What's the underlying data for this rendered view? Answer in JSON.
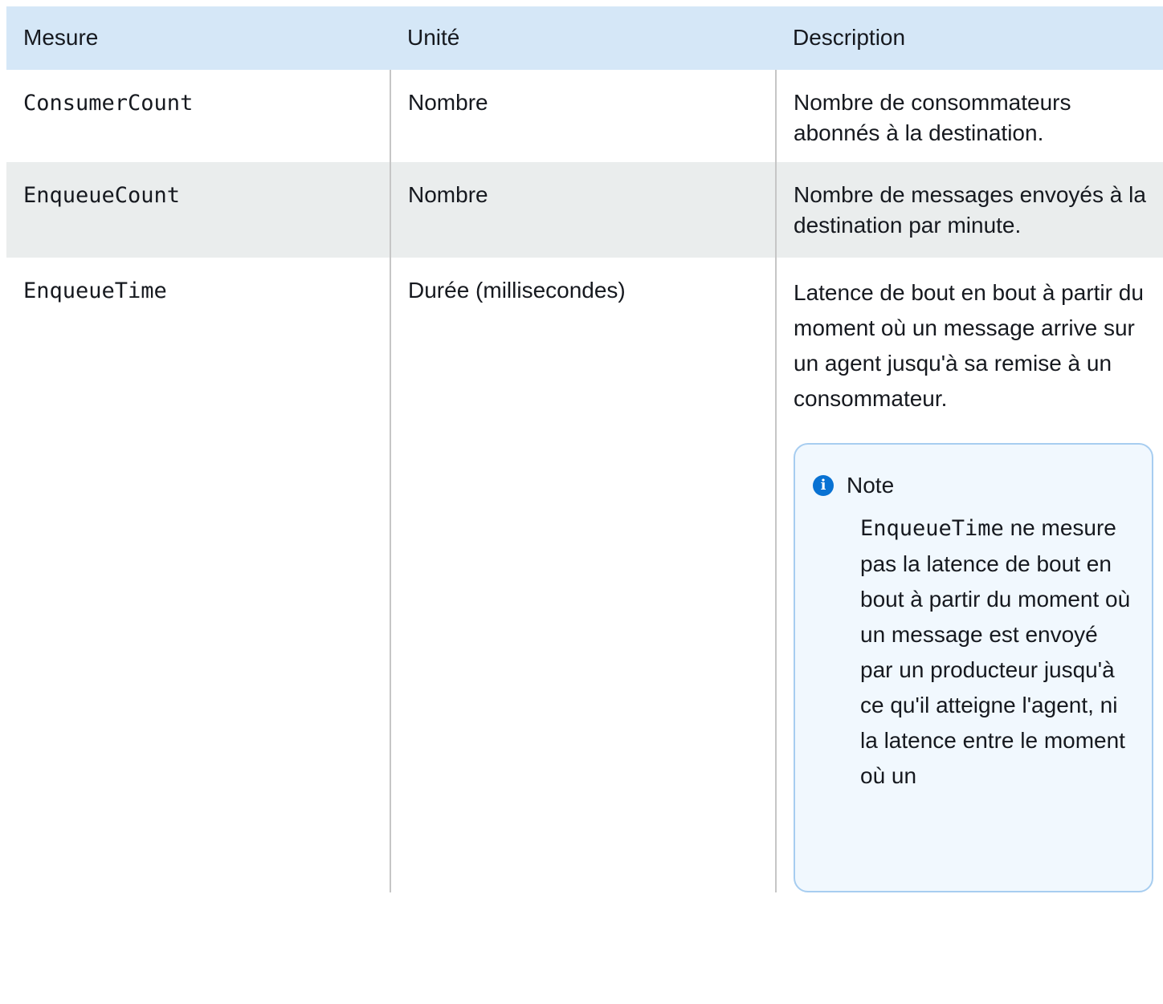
{
  "table": {
    "headers": [
      "Mesure",
      "Unité",
      "Description"
    ],
    "rows": [
      {
        "metric": "ConsumerCount",
        "unit": "Nombre",
        "description": "Nombre de consommateurs abonnés à la destination."
      },
      {
        "metric": "EnqueueCount",
        "unit": "Nombre",
        "description": "Nombre de messages envoyés à la destination par minute."
      },
      {
        "metric": "EnqueueTime",
        "unit": "Durée (millisecondes)",
        "description": "Latence de bout en bout à partir du moment où un message arrive sur un agent jusqu'à sa remise à un consommateur.",
        "note": {
          "title": "Note",
          "code": "EnqueueTime",
          "text": " ne mesure pas la latence de bout en bout à partir du moment où un message est envoyé par un producteur jusqu'à ce qu'il atteigne l'agent, ni la latence entre le moment où un"
        }
      }
    ]
  },
  "colors": {
    "header_bg": "#d5e7f7",
    "stripe_bg": "#eaeded",
    "note_bg": "#f1f8fe",
    "note_border": "#a7cdf0",
    "info_icon": "#0972d3"
  },
  "icons": {
    "note_icon": "info-icon"
  }
}
